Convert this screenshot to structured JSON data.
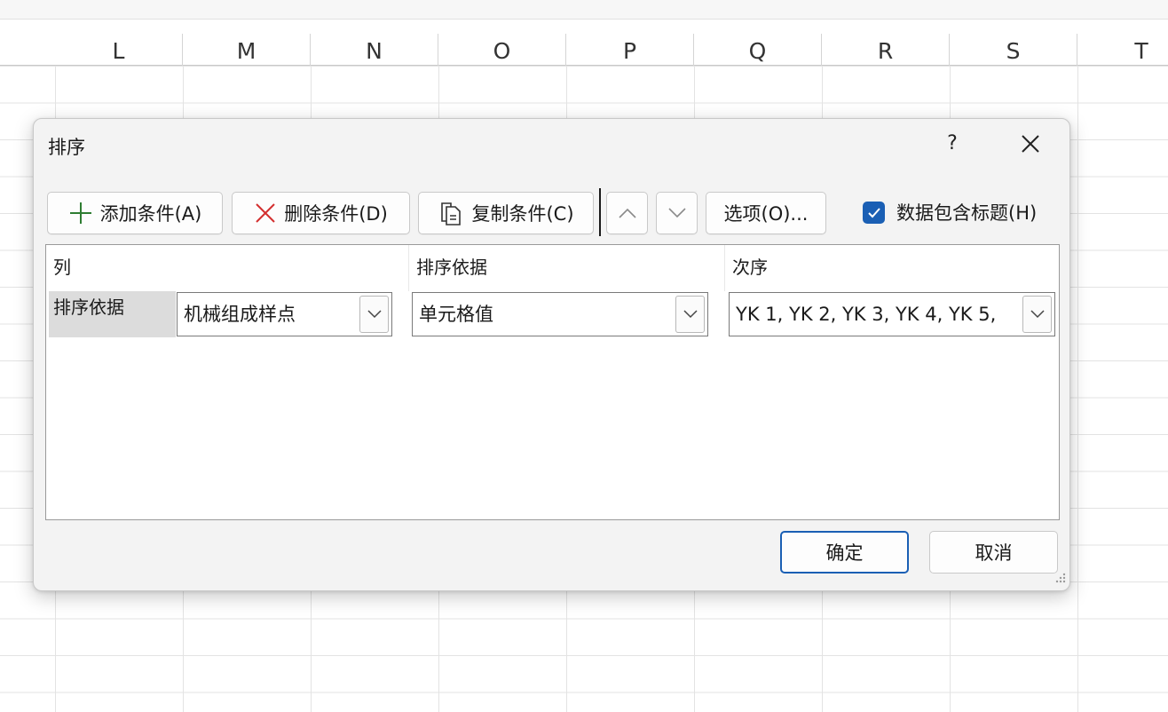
{
  "sheet": {
    "columns": [
      "L",
      "M",
      "N",
      "O",
      "P",
      "Q",
      "R",
      "S",
      "T"
    ]
  },
  "dialog": {
    "title": "排序",
    "help_label": "?",
    "toolbar": {
      "add_label": "添加条件(A)",
      "delete_label": "删除条件(D)",
      "copy_label": "复制条件(C)",
      "options_label": "选项(O)...",
      "header_checkbox_label": "数据包含标题(H)",
      "header_checked": true
    },
    "table": {
      "headers": {
        "column": "列",
        "sort_on": "排序依据",
        "order": "次序"
      },
      "rows": [
        {
          "label": "排序依据",
          "column_value": "机械组成样点",
          "sort_on_value": "单元格值",
          "order_value": "YK 1, YK 2, YK 3, YK 4, YK 5,"
        }
      ]
    },
    "ok_label": "确定",
    "cancel_label": "取消"
  },
  "colors": {
    "accent": "#1a5fb4",
    "add_icon": "#2e7d32",
    "delete_icon": "#d32f2f"
  },
  "icons": {
    "add": "plus-icon",
    "delete": "x-icon",
    "copy": "copy-document-icon",
    "up": "chevron-up-icon",
    "down": "chevron-down-icon",
    "close": "close-icon",
    "check": "checkmark-icon"
  }
}
